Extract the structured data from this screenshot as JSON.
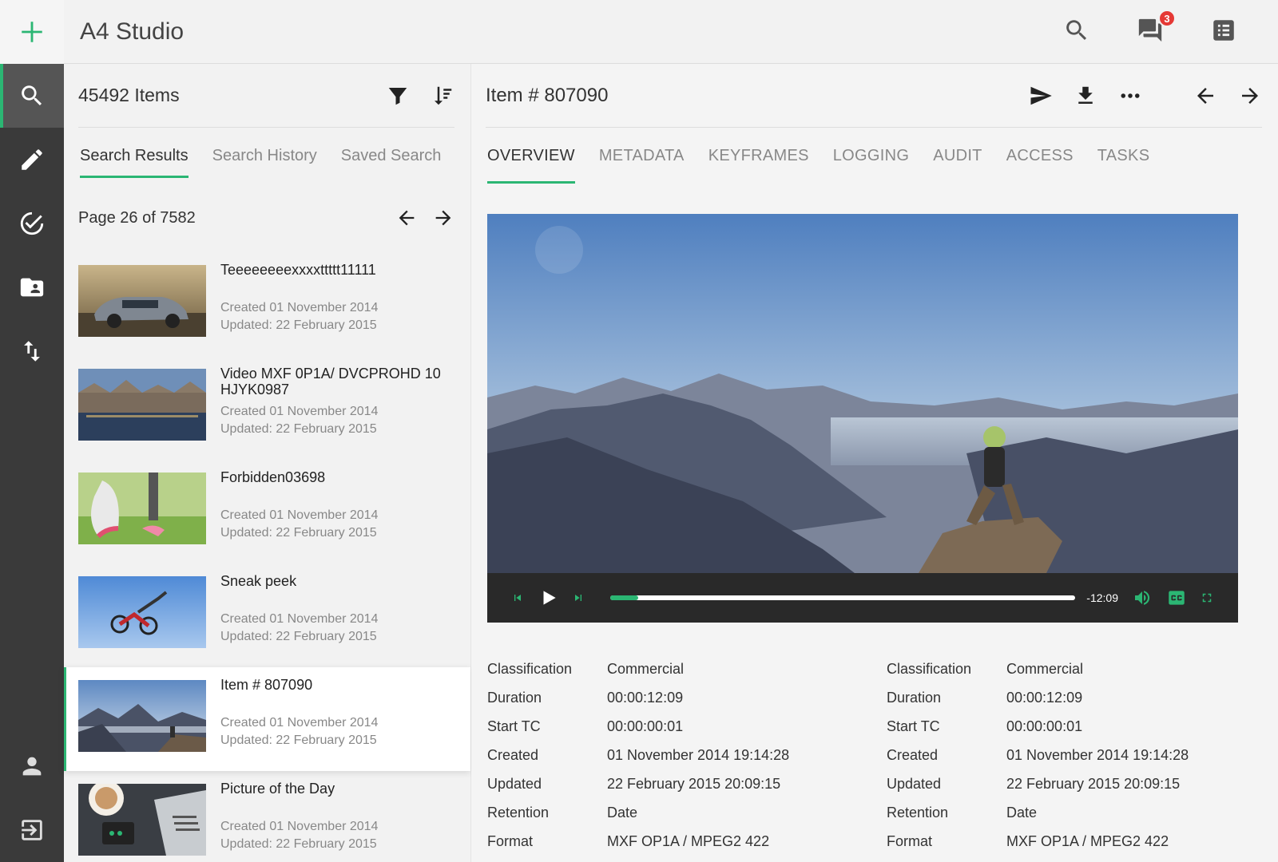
{
  "app": {
    "title": "A4 Studio",
    "accent": "#2bb673",
    "notifications": "3"
  },
  "rail": {
    "top": [
      "add-icon"
    ],
    "items": [
      "search-icon",
      "edit-icon",
      "check-circle-icon",
      "folder-shared-icon",
      "transfer-icon"
    ],
    "bottom": [
      "user-icon",
      "logout-icon"
    ]
  },
  "results": {
    "count": "45492 Items",
    "tabs": [
      "Search Results",
      "Search History",
      "Saved Search"
    ],
    "page": "Page 26 of 7582",
    "items": [
      {
        "name": "Teeeeeeeexxxxttttt11111",
        "created": "Created 01 November 2014",
        "updated": "Updated: 22 February 2015"
      },
      {
        "name": "Video MXF 0P1A/ DVCPROHD 10 HJYK0987",
        "created": "Created 01 November 2014",
        "updated": "Updated: 22 February 2015"
      },
      {
        "name": "Forbidden03698",
        "created": "Created 01 November 2014",
        "updated": "Updated: 22 February 2015"
      },
      {
        "name": "Sneak peek",
        "created": "Created 01 November 2014",
        "updated": "Updated: 22 February 2015"
      },
      {
        "name": "Item # 807090",
        "created": "Created 01 November 2014",
        "updated": "Updated: 22 February 2015"
      },
      {
        "name": "Picture of the Day",
        "created": "Created 01 November 2014",
        "updated": "Updated: 22 February 2015"
      }
    ]
  },
  "detail": {
    "title": "Item # 807090",
    "tabs": [
      "OVERVIEW",
      "METADATA",
      "KEYFRAMES",
      "LOGGING",
      "AUDIT",
      "ACCESS",
      "TASKS"
    ],
    "player": {
      "time": "-12:09",
      "progress": 0.06
    },
    "props_left": [
      {
        "k": "Classification",
        "v": "Commercial"
      },
      {
        "k": "Duration",
        "v": "00:00:12:09"
      },
      {
        "k": "Start TC",
        "v": "00:00:00:01"
      },
      {
        "k": "Created",
        "v": "01 November 2014 19:14:28"
      },
      {
        "k": "Updated",
        "v": "22 February 2015 20:09:15"
      },
      {
        "k": "Retention",
        "v": "Date"
      },
      {
        "k": "Format",
        "v": "MXF OP1A / MPEG2 422"
      }
    ],
    "props_right": [
      {
        "k": "Classification",
        "v": "Commercial"
      },
      {
        "k": "Duration",
        "v": "00:00:12:09"
      },
      {
        "k": "Start TC",
        "v": "00:00:00:01"
      },
      {
        "k": "Created",
        "v": "01 November 2014 19:14:28"
      },
      {
        "k": "Updated",
        "v": "22 February 2015 20:09:15"
      },
      {
        "k": "Retention",
        "v": "Date"
      },
      {
        "k": "Format",
        "v": "MXF OP1A / MPEG2 422"
      }
    ]
  }
}
